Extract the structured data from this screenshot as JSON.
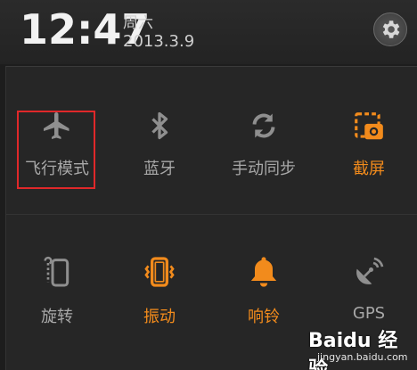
{
  "header": {
    "time": "12:47",
    "weekday": "周六",
    "date": "2013.3.9",
    "settings_icon": "gear-icon"
  },
  "toggles_row1": [
    {
      "label": "飞行模式",
      "icon": "airplane-icon",
      "active": false
    },
    {
      "label": "蓝牙",
      "icon": "bluetooth-icon",
      "active": false
    },
    {
      "label": "手动同步",
      "icon": "sync-icon",
      "active": false
    },
    {
      "label": "截屏",
      "icon": "screenshot-icon",
      "active": true
    }
  ],
  "toggles_row2": [
    {
      "label": "旋转",
      "icon": "rotate-icon",
      "active": false
    },
    {
      "label": "振动",
      "icon": "vibrate-icon",
      "active": true
    },
    {
      "label": "响铃",
      "icon": "bell-icon",
      "active": true
    },
    {
      "label": "GPS",
      "icon": "gps-icon",
      "active": false
    }
  ],
  "watermark": {
    "brand": "Baidu 经验",
    "url": "jingyan.baidu.com"
  },
  "colors": {
    "accent_on": "#f28b1c",
    "inactive": "#a8a8a8",
    "highlight_box": "#e0282a"
  }
}
